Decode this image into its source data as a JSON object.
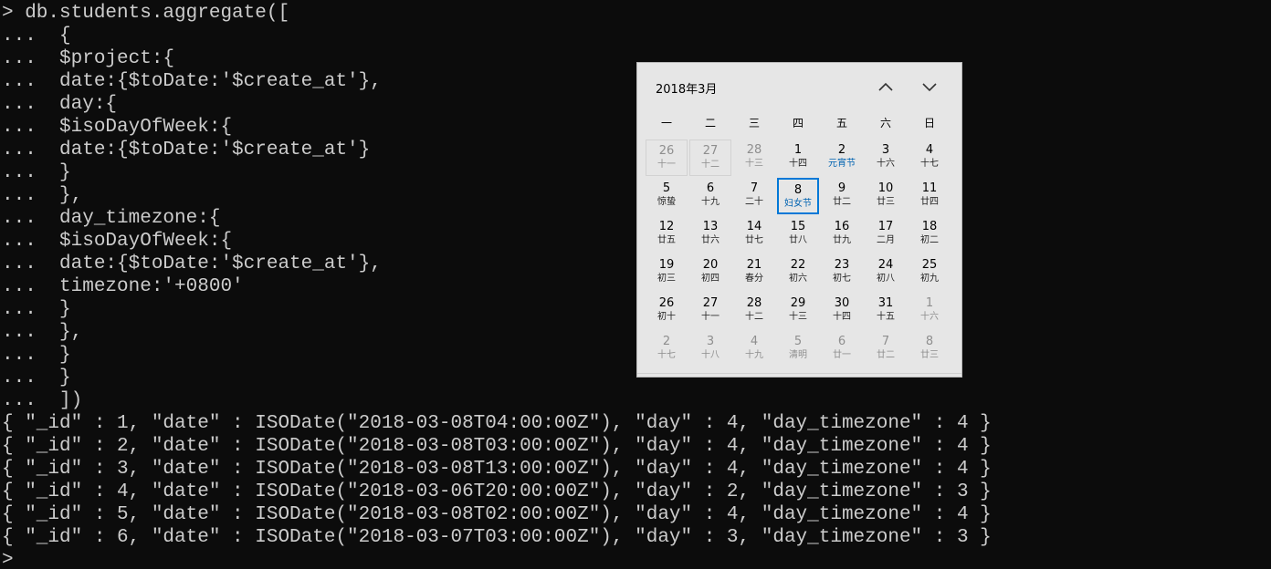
{
  "terminal": {
    "lines": [
      "> db.students.aggregate([",
      "...  {",
      "...  $project:{",
      "...  date:{$toDate:'$create_at'},",
      "...  day:{",
      "...  $isoDayOfWeek:{",
      "...  date:{$toDate:'$create_at'}",
      "...  }",
      "...  },",
      "...  day_timezone:{",
      "...  $isoDayOfWeek:{",
      "...  date:{$toDate:'$create_at'},",
      "...  timezone:'+0800'",
      "...  }",
      "...  },",
      "...  }",
      "...  }",
      "...  ])",
      "{ \"_id\" : 1, \"date\" : ISODate(\"2018-03-08T04:00:00Z\"), \"day\" : 4, \"day_timezone\" : 4 }",
      "{ \"_id\" : 2, \"date\" : ISODate(\"2018-03-08T03:00:00Z\"), \"day\" : 4, \"day_timezone\" : 4 }",
      "{ \"_id\" : 3, \"date\" : ISODate(\"2018-03-08T13:00:00Z\"), \"day\" : 4, \"day_timezone\" : 4 }",
      "{ \"_id\" : 4, \"date\" : ISODate(\"2018-03-06T20:00:00Z\"), \"day\" : 2, \"day_timezone\" : 3 }",
      "{ \"_id\" : 5, \"date\" : ISODate(\"2018-03-08T02:00:00Z\"), \"day\" : 4, \"day_timezone\" : 4 }",
      "{ \"_id\" : 6, \"date\" : ISODate(\"2018-03-07T03:00:00Z\"), \"day\" : 3, \"day_timezone\" : 3 }",
      ">"
    ]
  },
  "calendar": {
    "month_label": "2018年3月",
    "nav_up_icon": "chevron-up-icon",
    "nav_down_icon": "chevron-down-icon",
    "weekdays": [
      "一",
      "二",
      "三",
      "四",
      "五",
      "六",
      "日"
    ],
    "weeks": [
      [
        {
          "day": "26",
          "lunar": "十一",
          "state": "other"
        },
        {
          "day": "27",
          "lunar": "十二",
          "state": "other"
        },
        {
          "day": "28",
          "lunar": "十三",
          "state": "other"
        },
        {
          "day": "1",
          "lunar": "十四",
          "state": "cur"
        },
        {
          "day": "2",
          "lunar": "元宵节",
          "state": "festival"
        },
        {
          "day": "3",
          "lunar": "十六",
          "state": "cur"
        },
        {
          "day": "4",
          "lunar": "十七",
          "state": "cur"
        }
      ],
      [
        {
          "day": "5",
          "lunar": "惊蛰",
          "state": "cur"
        },
        {
          "day": "6",
          "lunar": "十九",
          "state": "cur"
        },
        {
          "day": "7",
          "lunar": "二十",
          "state": "cur"
        },
        {
          "day": "8",
          "lunar": "妇女节",
          "state": "today"
        },
        {
          "day": "9",
          "lunar": "廿二",
          "state": "cur"
        },
        {
          "day": "10",
          "lunar": "廿三",
          "state": "cur"
        },
        {
          "day": "11",
          "lunar": "廿四",
          "state": "cur"
        }
      ],
      [
        {
          "day": "12",
          "lunar": "廿五",
          "state": "cur"
        },
        {
          "day": "13",
          "lunar": "廿六",
          "state": "cur"
        },
        {
          "day": "14",
          "lunar": "廿七",
          "state": "cur"
        },
        {
          "day": "15",
          "lunar": "廿八",
          "state": "cur"
        },
        {
          "day": "16",
          "lunar": "廿九",
          "state": "cur"
        },
        {
          "day": "17",
          "lunar": "二月",
          "state": "cur"
        },
        {
          "day": "18",
          "lunar": "初二",
          "state": "cur"
        }
      ],
      [
        {
          "day": "19",
          "lunar": "初三",
          "state": "cur"
        },
        {
          "day": "20",
          "lunar": "初四",
          "state": "cur"
        },
        {
          "day": "21",
          "lunar": "春分",
          "state": "cur"
        },
        {
          "day": "22",
          "lunar": "初六",
          "state": "cur"
        },
        {
          "day": "23",
          "lunar": "初七",
          "state": "cur"
        },
        {
          "day": "24",
          "lunar": "初八",
          "state": "cur"
        },
        {
          "day": "25",
          "lunar": "初九",
          "state": "cur"
        }
      ],
      [
        {
          "day": "26",
          "lunar": "初十",
          "state": "cur"
        },
        {
          "day": "27",
          "lunar": "十一",
          "state": "cur"
        },
        {
          "day": "28",
          "lunar": "十二",
          "state": "cur"
        },
        {
          "day": "29",
          "lunar": "十三",
          "state": "cur"
        },
        {
          "day": "30",
          "lunar": "十四",
          "state": "cur"
        },
        {
          "day": "31",
          "lunar": "十五",
          "state": "cur"
        },
        {
          "day": "1",
          "lunar": "十六",
          "state": "other"
        }
      ],
      [
        {
          "day": "2",
          "lunar": "十七",
          "state": "other"
        },
        {
          "day": "3",
          "lunar": "十八",
          "state": "other"
        },
        {
          "day": "4",
          "lunar": "十九",
          "state": "other"
        },
        {
          "day": "5",
          "lunar": "清明",
          "state": "other"
        },
        {
          "day": "6",
          "lunar": "廿一",
          "state": "other"
        },
        {
          "day": "7",
          "lunar": "廿二",
          "state": "other"
        },
        {
          "day": "8",
          "lunar": "廿三",
          "state": "other"
        }
      ]
    ],
    "colors": {
      "background": "#e6e6e6",
      "today_border": "#0078d7",
      "festival_text": "#0063b1",
      "dim_text": "#8e8e8e"
    }
  }
}
